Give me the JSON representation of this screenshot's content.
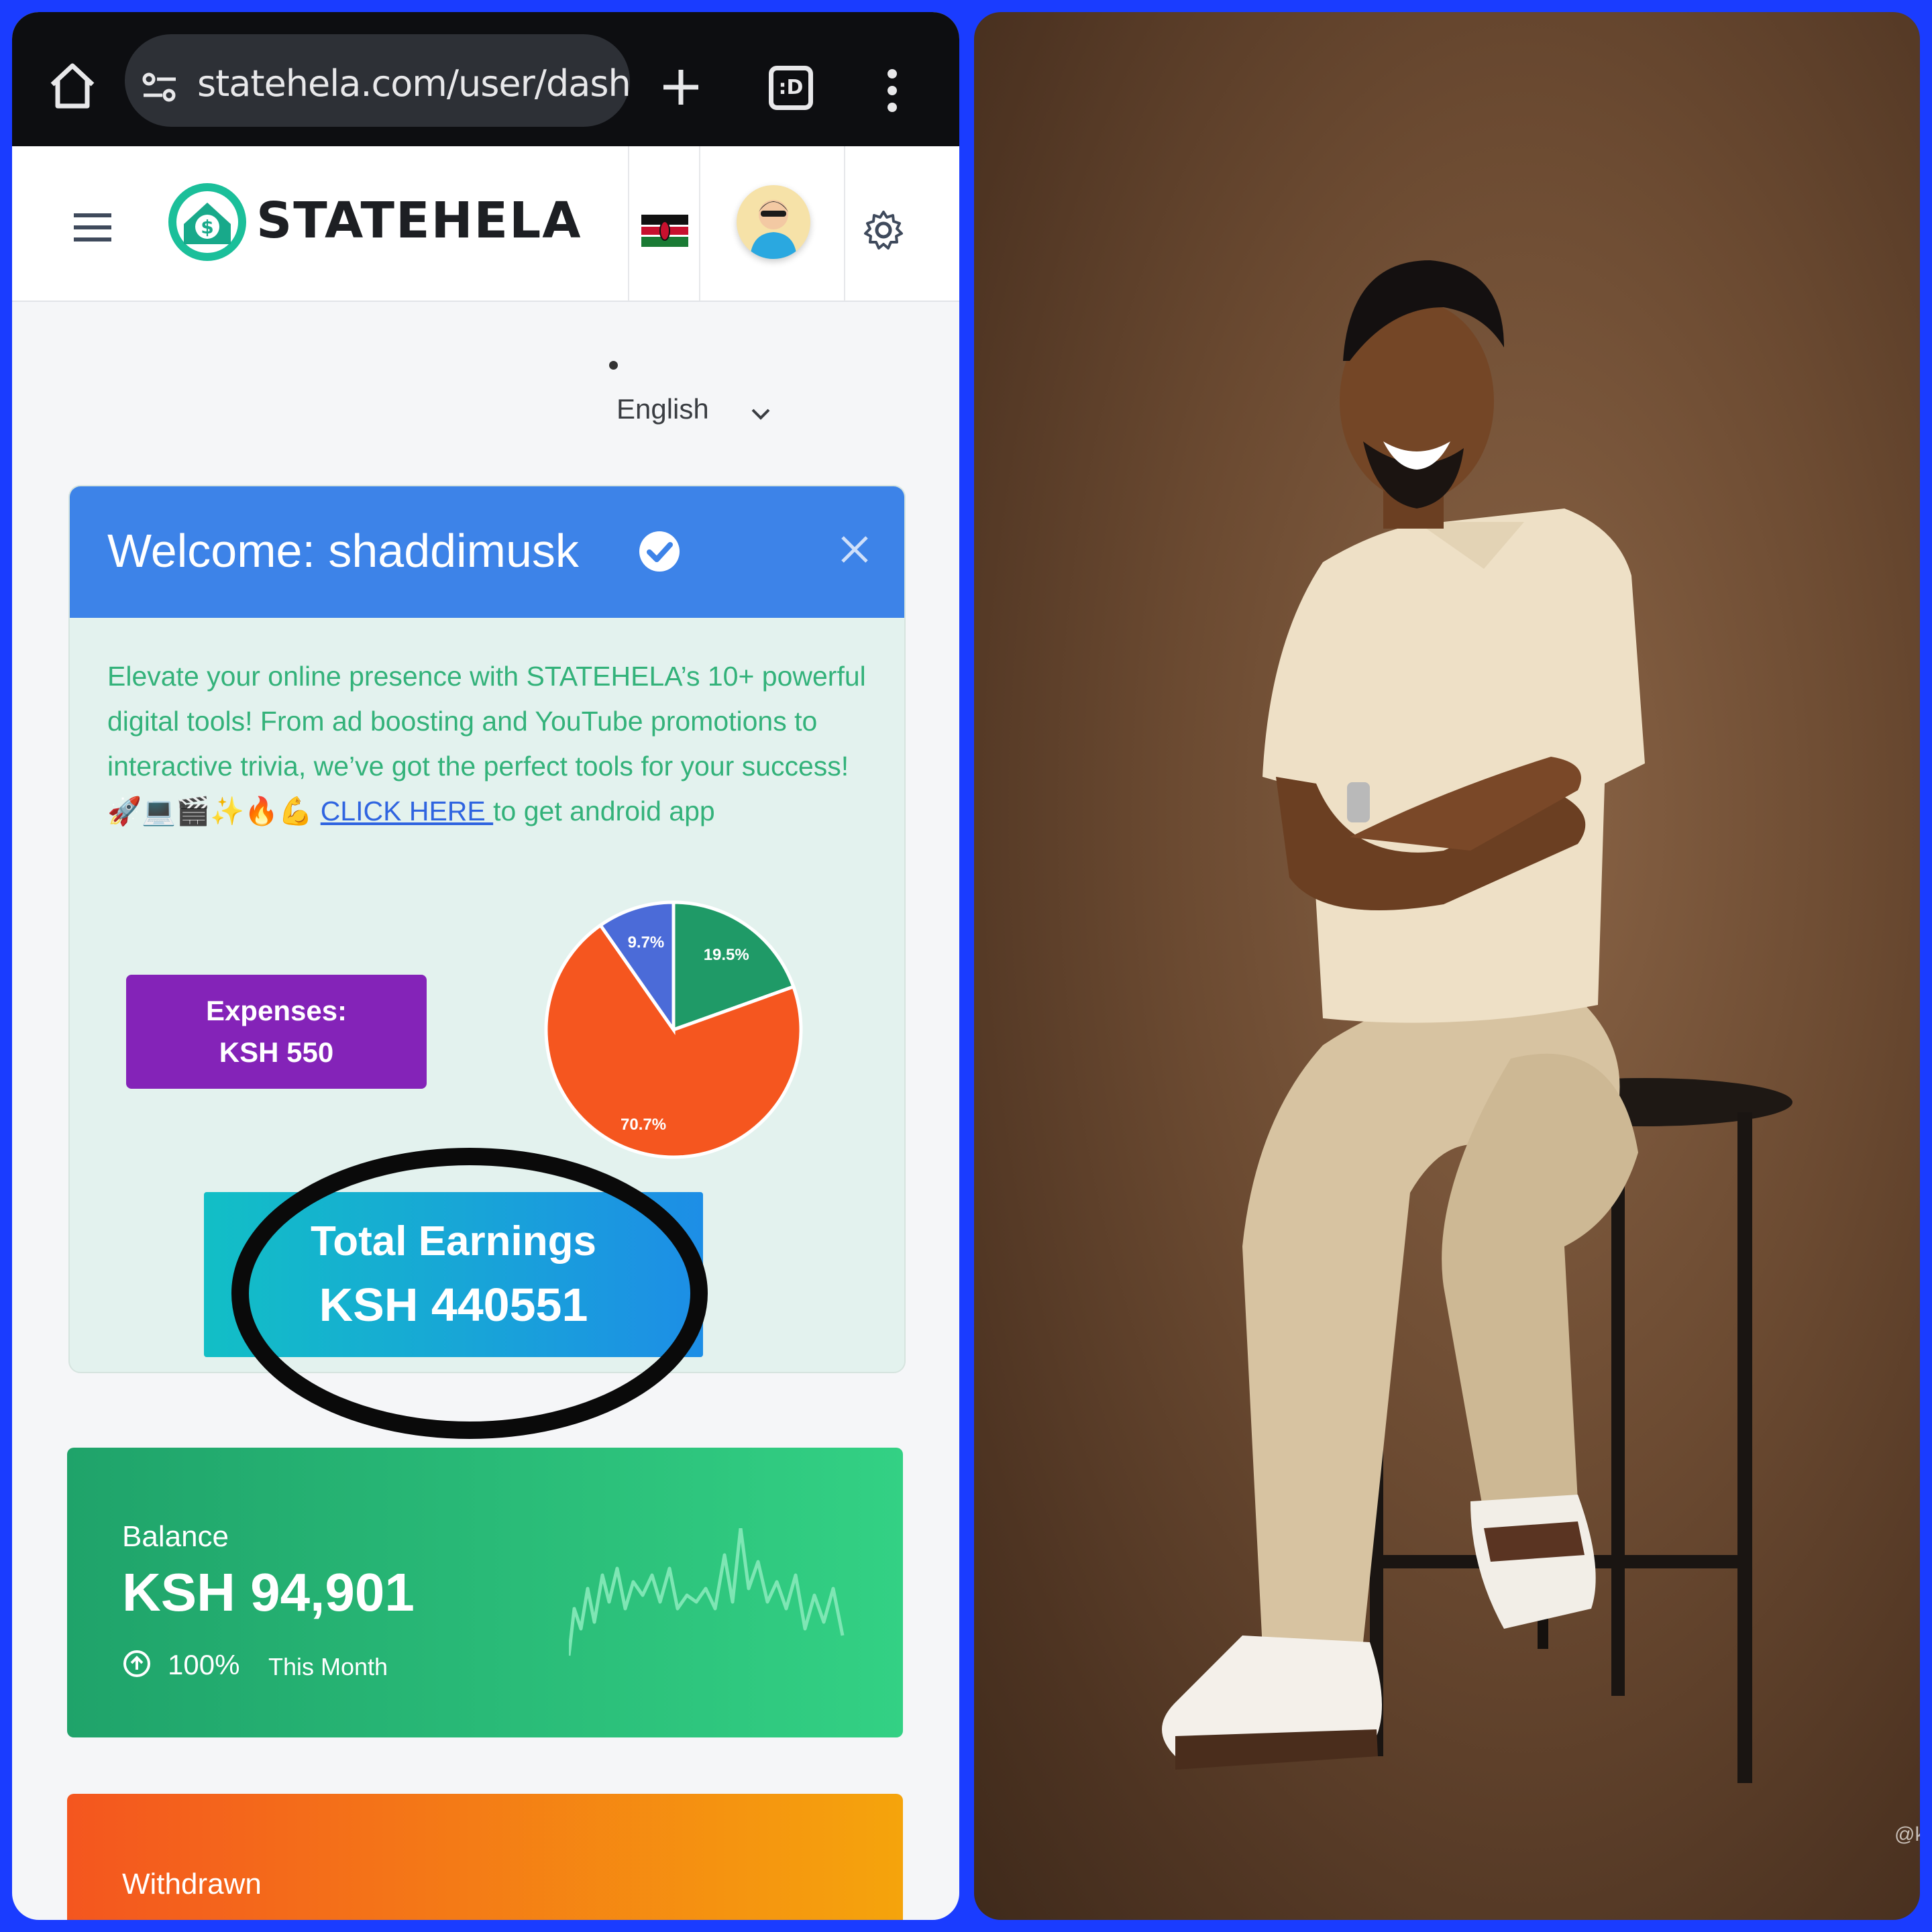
{
  "browser": {
    "url": "statehela.com/user/dash",
    "tabs_count": ":D",
    "icons": [
      "home-icon",
      "tune-icon",
      "plus-icon",
      "tab-switcher-icon",
      "more-vert-icon"
    ]
  },
  "header": {
    "brand": "STATEHELA",
    "icons": [
      "hamburger-icon",
      "logo-icon",
      "kenya-flag-icon",
      "avatar",
      "gear-icon"
    ]
  },
  "language": {
    "selected": "English"
  },
  "welcome": {
    "title": "Welcome: shaddimusk",
    "promo_text": "Elevate your online presence with STATEHELA’s 10+ powerful digital tools! From ad boosting and YouTube promotions to interactive trivia, we’ve got the perfect tools for your success! 🚀💻🎬✨🔥💪 ",
    "link_text": "CLICK HERE ",
    "promo_tail": "to get android app",
    "expenses_label": "Expenses: KSH 550",
    "earnings_label": "Total Earnings",
    "earnings_value": "KSH 440551"
  },
  "chart_data": {
    "type": "pie",
    "slices": [
      {
        "label": "19.5%",
        "value": 19.5,
        "color": "#1f9a67"
      },
      {
        "label": "70.7%",
        "value": 70.7,
        "color": "#f5561f"
      },
      {
        "label": "9.7%",
        "value": 9.7,
        "color": "#4b6bd8"
      }
    ]
  },
  "balance": {
    "label": "Balance",
    "value": "KSH 94,901",
    "change": "100%",
    "period": "This Month"
  },
  "withdrawn": {
    "label": "Withdrawn"
  },
  "photo": {
    "watermark": "@ke"
  },
  "colors": {
    "background": "#1a3cff",
    "welcome_header": "#3d83e8",
    "expenses": "#8423b8",
    "balance": "#28bb78",
    "withdrawn": "#f4801a"
  }
}
